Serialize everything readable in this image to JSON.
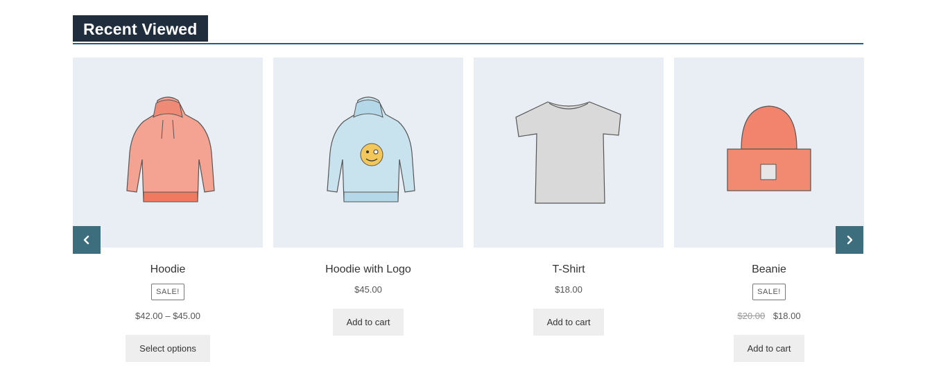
{
  "section": {
    "title": "Recent Viewed"
  },
  "products": [
    {
      "name": "Hoodie",
      "badge": "SALE!",
      "price": "$42.00 – $45.00",
      "button": "Select options",
      "image_icon": "hoodie-icon"
    },
    {
      "name": "Hoodie with Logo",
      "price": "$45.00",
      "button": "Add to cart",
      "image_icon": "hoodie-logo-icon"
    },
    {
      "name": "T-Shirt",
      "price": "$18.00",
      "button": "Add to cart",
      "image_icon": "tshirt-icon"
    },
    {
      "name": "Beanie",
      "badge": "SALE!",
      "old_price": "$20.00",
      "price": "$18.00",
      "button": "Add to cart",
      "image_icon": "beanie-icon"
    }
  ],
  "nav": {
    "prev_icon": "chevron-left-icon",
    "next_icon": "chevron-right-icon"
  },
  "colors": {
    "header_bg": "#1f2d3d",
    "accent_line": "#1f5b91",
    "arrow_bg": "#3d6e7e",
    "image_bg": "#e8eef3",
    "button_bg": "#eeeeee"
  }
}
